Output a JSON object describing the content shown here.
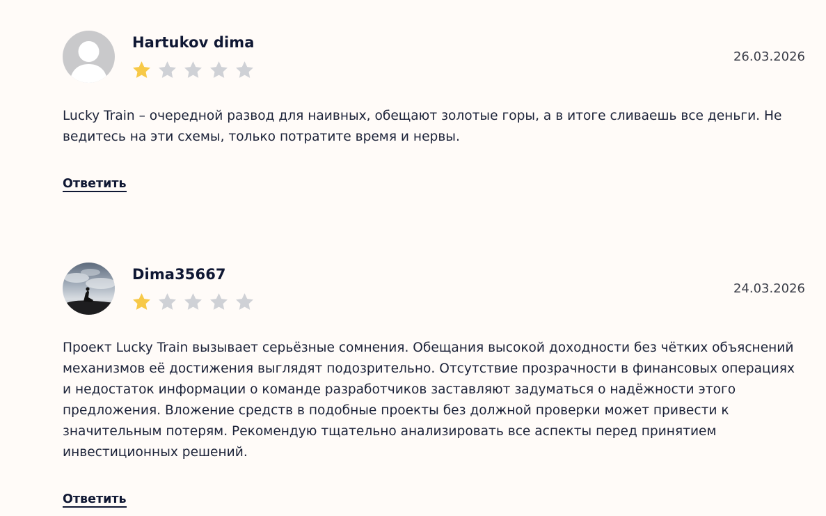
{
  "reviews": [
    {
      "author": "Hartukov dima",
      "date": "26.03.2026",
      "rating": 1,
      "max_rating": 5,
      "avatar": "default-user-avatar",
      "text": "Lucky Train – очередной развод для наивных, обещают золотые горы, а в итоге сливаешь все деньги. Не ведитесь на эти схемы, только потратите время и нервы.",
      "reply_label": "Ответить"
    },
    {
      "author": "Dima35667",
      "date": "24.03.2026",
      "rating": 1,
      "max_rating": 5,
      "avatar": "photo-avatar-silhouette-sky",
      "text": "Проект Lucky Train вызывает серьёзные сомнения. Обещания высокой доходности без чётких объяснений механизмов её достижения выглядят подозрительно. Отсутствие прозрачности в финансовых операциях и недостаток информации о команде разработчиков заставляют задуматься о надёжности этого предложения. Вложение средств в подобные проекты без должной проверки может привести к значительным потерям. Рекомендую тщательно анализировать все аспекты перед принятием инвестиционных решений.",
      "reply_label": "Ответить"
    }
  ],
  "colors": {
    "background": "#fffbf8",
    "star_filled": "#f7c948",
    "star_empty": "#cfd1d6",
    "text": "#1b2238",
    "author": "#0f1733"
  }
}
